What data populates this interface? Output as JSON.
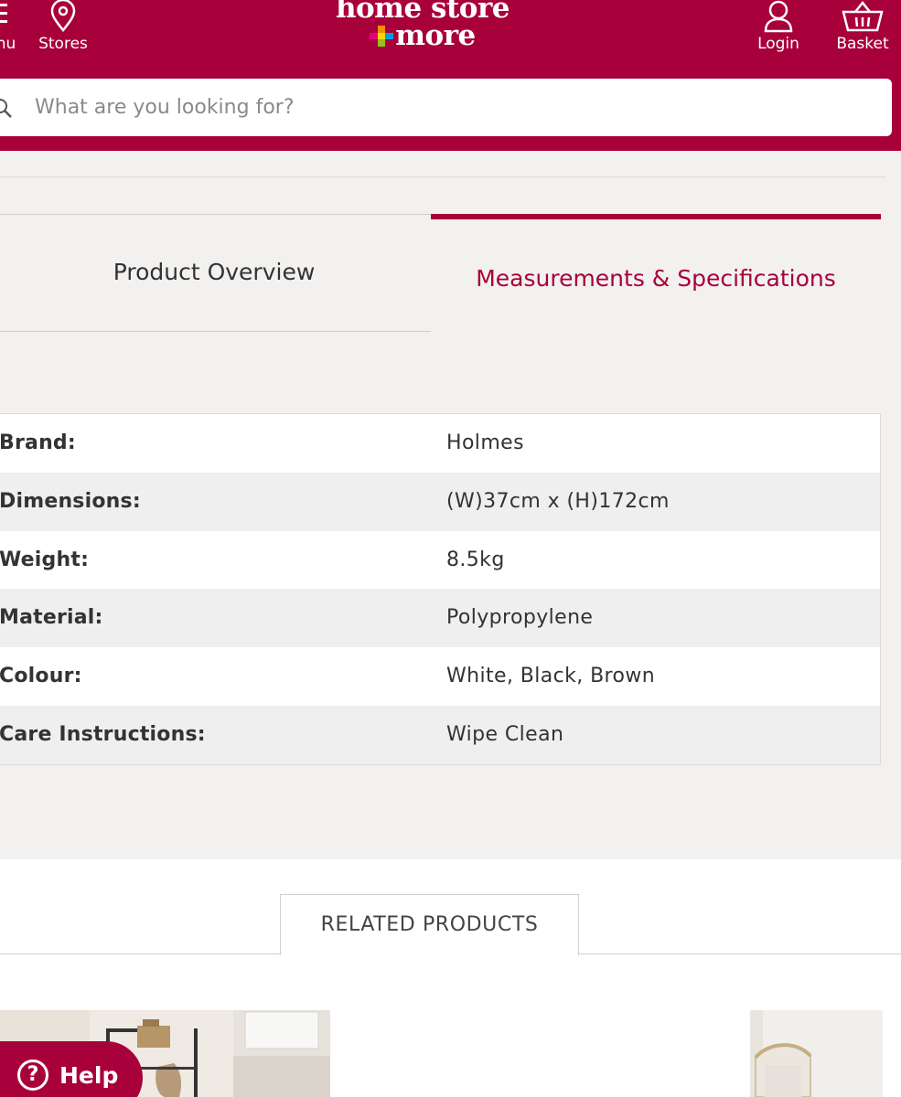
{
  "header": {
    "menu_label": "Menu",
    "stores_label": "Stores",
    "logo_line1": "home store",
    "logo_line2": "more",
    "login_label": "Login",
    "basket_label": "Basket",
    "brand_color": "#a8003a"
  },
  "search": {
    "placeholder": "What are you looking for?"
  },
  "tabs": {
    "overview_label": "Product Overview",
    "measurements_label": "Measurements & Specifications",
    "active": "Measurements & Specifications"
  },
  "specs": [
    {
      "label": "Brand:",
      "value": "Holmes"
    },
    {
      "label": "Dimensions:",
      "value": "(W)37cm x (H)172cm"
    },
    {
      "label": "Weight:",
      "value": "8.5kg"
    },
    {
      "label": "Material:",
      "value": "Polypropylene"
    },
    {
      "label": "Colour:",
      "value": "White, Black, Brown"
    },
    {
      "label": "Care Instructions:",
      "value": "Wipe Clean"
    }
  ],
  "related": {
    "heading": "RELATED PRODUCTS"
  },
  "help": {
    "label": "Help",
    "icon": "?"
  }
}
